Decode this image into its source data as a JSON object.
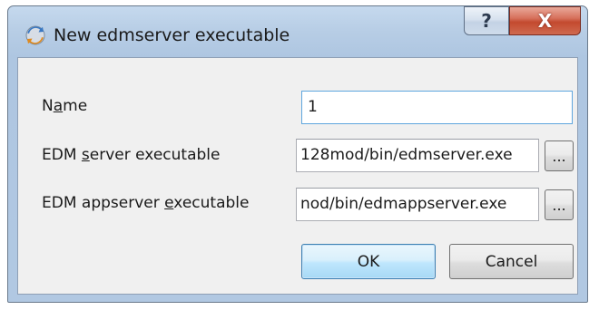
{
  "window": {
    "title": "New edmserver executable",
    "help_label": "?",
    "close_label": "X"
  },
  "form": {
    "name": {
      "label_before": "N",
      "label_mnemonic": "a",
      "label_after": "me",
      "value": "1"
    },
    "server": {
      "label_before": "EDM ",
      "label_mnemonic": "s",
      "label_after": "erver executable",
      "value": "128mod/bin/edmserver.exe",
      "browse_label": "..."
    },
    "appserver": {
      "label_before": "EDM appserver ",
      "label_mnemonic": "e",
      "label_after": "xecutable",
      "value": "nod/bin/edmappserver.exe",
      "browse_label": "..."
    }
  },
  "buttons": {
    "ok_label": "OK",
    "cancel_label": "Cancel"
  },
  "colors": {
    "title_bar": "#b7cde5",
    "close_button": "#c34a2f",
    "default_button_border": "#3c7fb1",
    "focused_field_border": "#5fa6de"
  },
  "icons": {
    "app": "sync-circle-icon",
    "help": "question-mark-icon",
    "close": "close-x-icon"
  }
}
